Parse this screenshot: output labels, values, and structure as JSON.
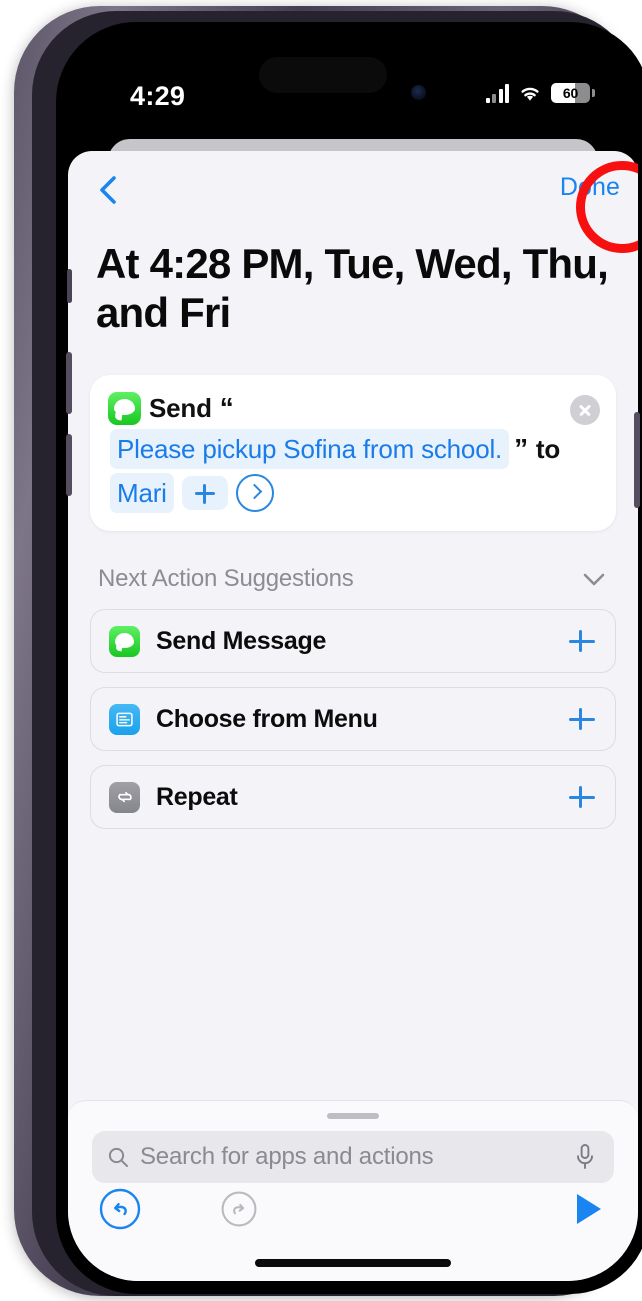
{
  "status_bar": {
    "time": "4:29",
    "battery_level": "60",
    "signal_icon": "cellular-signal-icon",
    "wifi_icon": "wifi-icon",
    "battery_icon": "battery-icon"
  },
  "nav": {
    "back_icon": "chevron-left-icon",
    "done_label": "Done"
  },
  "page": {
    "title": "At 4:28 PM, Tue, Wed, Thu, and Fri"
  },
  "action_card": {
    "app_icon": "messages-app-icon",
    "verb": "Send",
    "open_quote": "“",
    "message_text": "Please pickup Sofina from school.",
    "close_quote": "”",
    "preposition": "to",
    "recipient": "Mari",
    "add_icon": "plus-icon",
    "expand_icon": "chevron-right-circle-icon",
    "remove_icon": "close-circle-icon"
  },
  "suggestions": {
    "header": "Next Action Suggestions",
    "collapse_icon": "chevron-down-icon",
    "items": [
      {
        "label": "Send Message",
        "icon": "messages-app-icon",
        "add_icon": "plus-icon"
      },
      {
        "label": "Choose from Menu",
        "icon": "choose-from-menu-icon",
        "add_icon": "plus-icon"
      },
      {
        "label": "Repeat",
        "icon": "repeat-icon",
        "add_icon": "plus-icon"
      }
    ]
  },
  "search": {
    "placeholder": "Search for apps and actions",
    "value": "",
    "search_icon": "search-icon",
    "mic_icon": "microphone-icon"
  },
  "toolbar": {
    "undo_icon": "undo-icon",
    "redo_icon": "redo-icon",
    "run_icon": "play-icon"
  },
  "annotation": {
    "shape": "circle-highlight",
    "color": "#f61010",
    "target": "done-button"
  },
  "colors": {
    "accent_blue": "#1a84f0",
    "token_blue": "#1a7ce8",
    "token_bg": "#e8f2fd",
    "sheet_bg": "#f4f3f8",
    "messages_green": "#18c722",
    "annotation_red": "#f61010"
  }
}
